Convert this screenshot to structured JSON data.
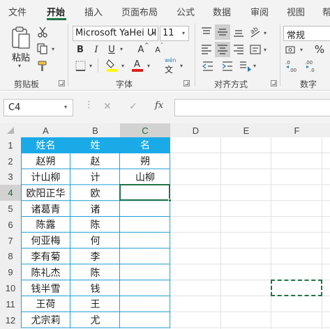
{
  "tabs": [
    "文件",
    "开始",
    "插入",
    "页面布局",
    "公式",
    "数据",
    "审阅",
    "视图",
    "帮"
  ],
  "active_tab": "开始",
  "ribbon": {
    "clipboard": {
      "paste_label": "粘贴",
      "group_label": "剪贴板"
    },
    "font": {
      "font_name": "Microsoft YaHei UI",
      "font_size": "11",
      "bold": "B",
      "italic": "I",
      "underline": "U",
      "grow": "A",
      "shrink": "A",
      "phonetic_top": "wén",
      "phonetic_bottom": "文",
      "group_label": "字体"
    },
    "alignment": {
      "group_label": "对齐方式"
    },
    "number": {
      "format": "常规",
      "percent": "%",
      "group_label": "数字"
    }
  },
  "formula_bar": {
    "name_box": "C4",
    "cancel": "✕",
    "enter": "✓",
    "fx": "fx",
    "formula": ""
  },
  "grid": {
    "columns": [
      "A",
      "B",
      "C",
      "D",
      "E",
      "F"
    ],
    "rows": [
      "1",
      "2",
      "3",
      "4",
      "5",
      "6",
      "7",
      "8",
      "9",
      "10",
      "11",
      "12",
      "13"
    ],
    "active_cell": "C4",
    "cells": [
      [
        "姓名",
        "姓",
        "名"
      ],
      [
        "赵朔",
        "赵",
        "朔"
      ],
      [
        "计山柳",
        "计",
        "山柳"
      ],
      [
        "欧阳正华",
        "欧",
        ""
      ],
      [
        "诸葛青",
        "诸",
        ""
      ],
      [
        "陈露",
        "陈",
        ""
      ],
      [
        "何亚梅",
        "何",
        ""
      ],
      [
        "李有菊",
        "李",
        ""
      ],
      [
        "陈礼杰",
        "陈",
        ""
      ],
      [
        "钱半雪",
        "钱",
        ""
      ],
      [
        "王荷",
        "王",
        ""
      ],
      [
        "尤宗莉",
        "尤",
        ""
      ]
    ]
  },
  "colors": {
    "header_fill": "#1aaae8",
    "table_border": "#1f9fd8",
    "accent": "#217346"
  }
}
